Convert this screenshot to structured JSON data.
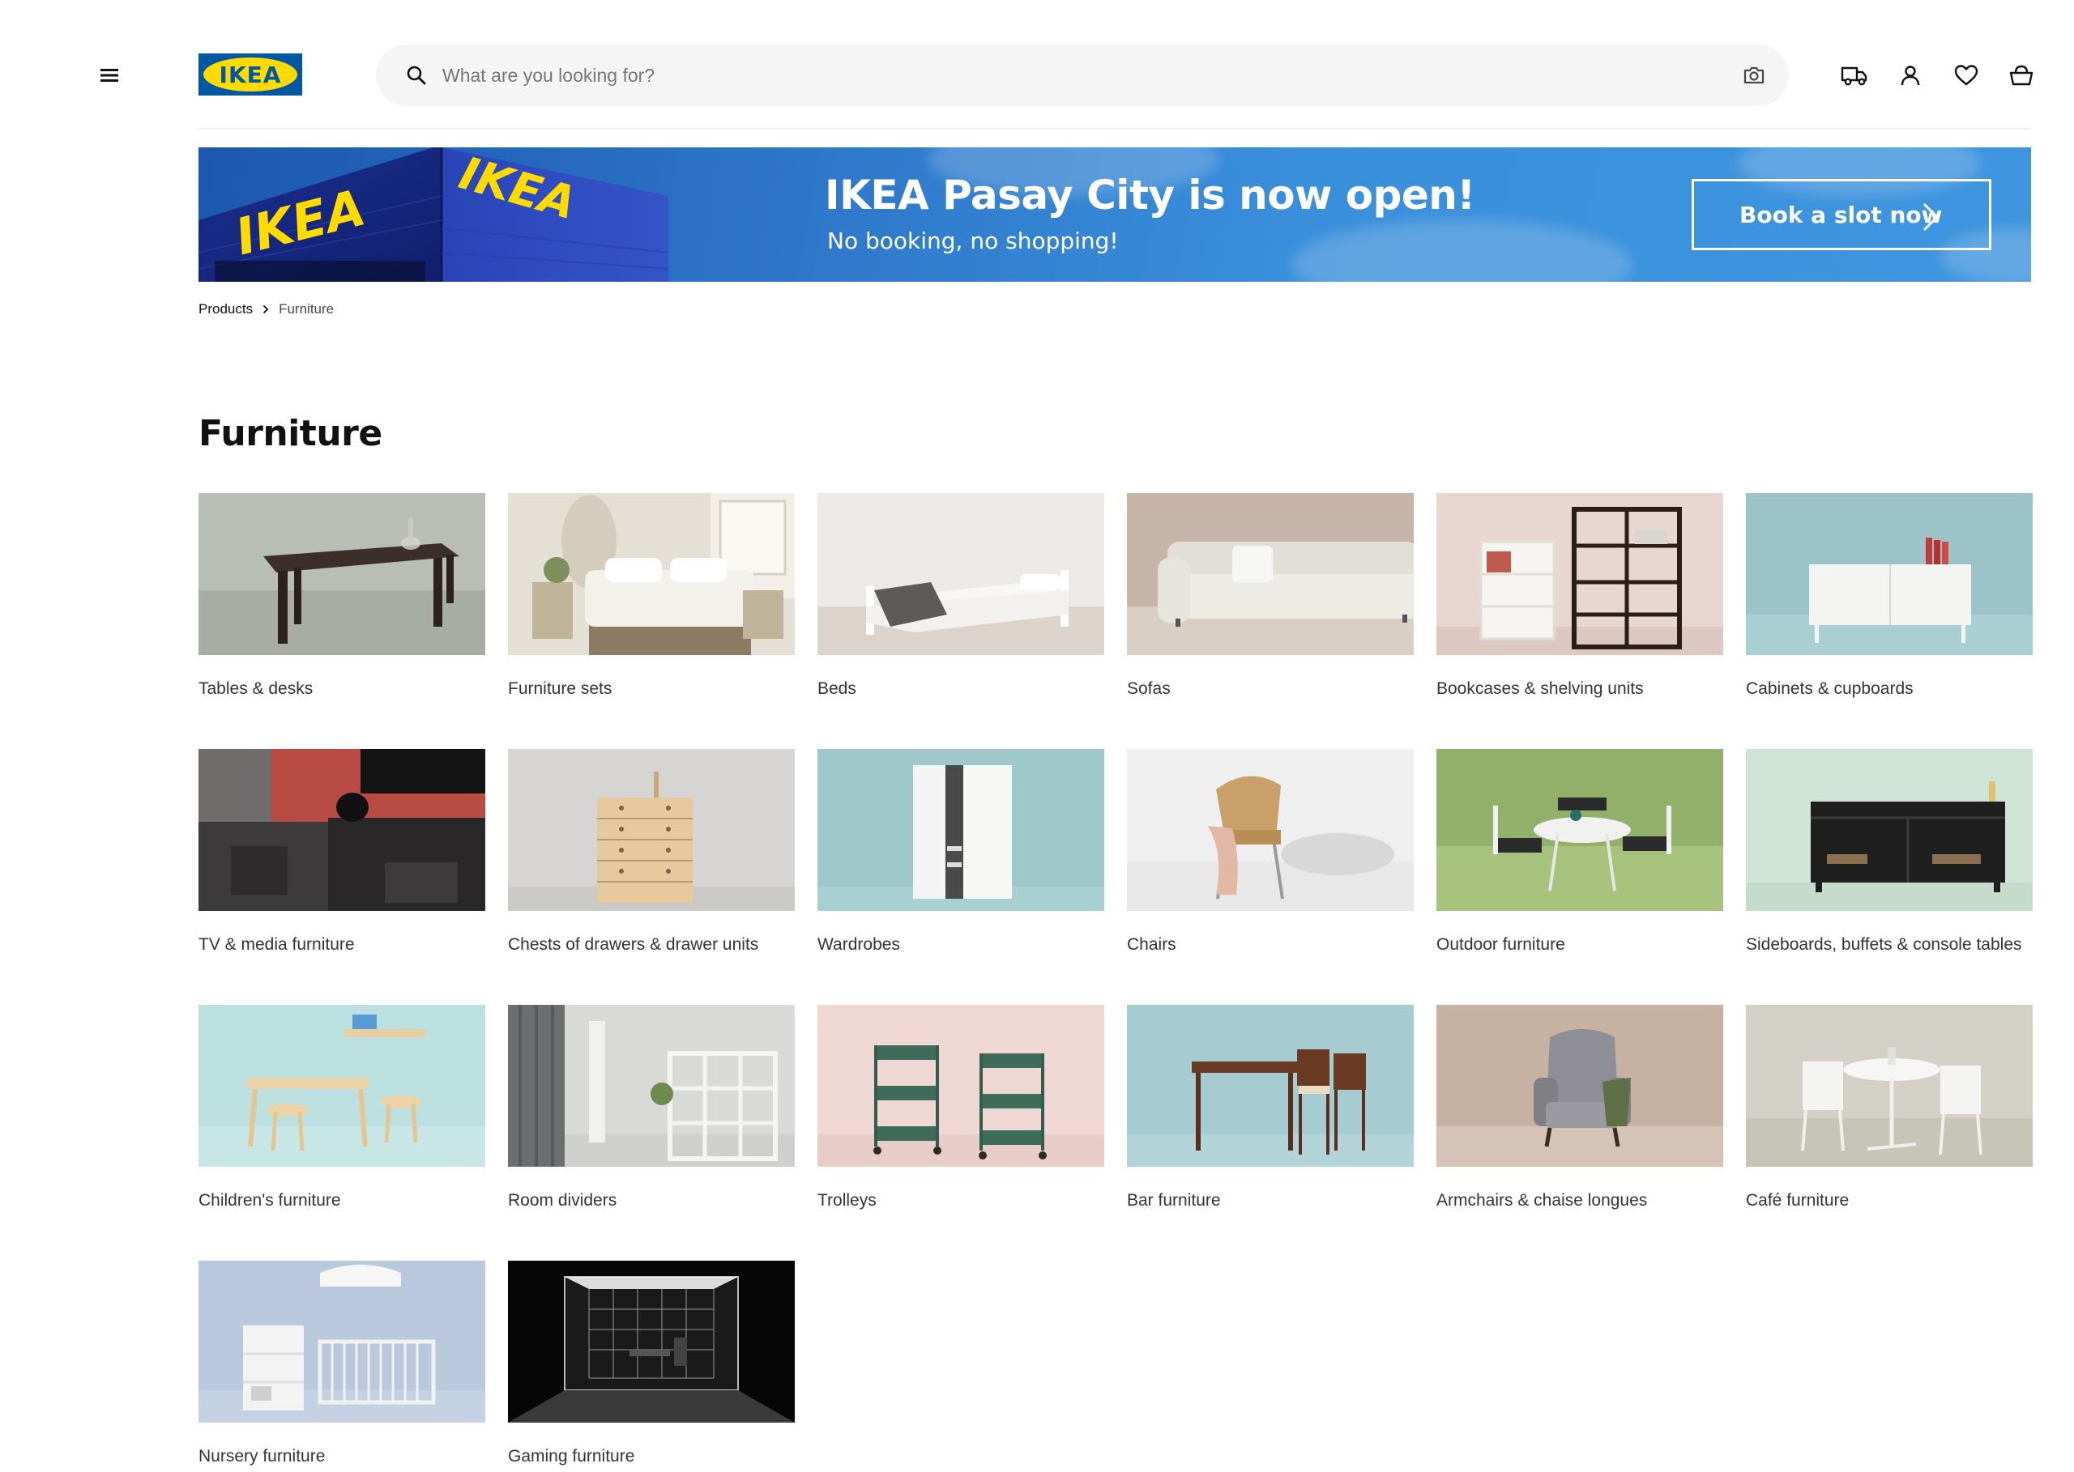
{
  "header": {
    "logo_text": "IKEA",
    "search": {
      "placeholder": "What are you looking for?"
    },
    "icons": [
      "menu-icon",
      "search-icon",
      "camera-icon",
      "truck-icon",
      "user-icon",
      "heart-icon",
      "basket-icon"
    ]
  },
  "banner": {
    "sign_text": "IKEA",
    "title": "IKEA Pasay City is now open!",
    "subtitle": "No booking, no shopping!",
    "button_label": "Book a slot now"
  },
  "breadcrumb": {
    "items": [
      "Products",
      "Furniture"
    ]
  },
  "page": {
    "title": "Furniture"
  },
  "categories": [
    {
      "label": "Tables & desks"
    },
    {
      "label": "Furniture sets"
    },
    {
      "label": "Beds"
    },
    {
      "label": "Sofas"
    },
    {
      "label": "Bookcases & shelving units"
    },
    {
      "label": "Cabinets & cupboards"
    },
    {
      "label": "TV & media furniture"
    },
    {
      "label": "Chests of drawers & drawer units"
    },
    {
      "label": "Wardrobes"
    },
    {
      "label": "Chairs"
    },
    {
      "label": "Outdoor furniture"
    },
    {
      "label": "Sideboards, buffets & console tables"
    },
    {
      "label": "Children's furniture"
    },
    {
      "label": "Room dividers"
    },
    {
      "label": "Trolleys"
    },
    {
      "label": "Bar furniture"
    },
    {
      "label": "Armchairs & chaise longues"
    },
    {
      "label": "Café furniture"
    },
    {
      "label": "Nursery furniture"
    },
    {
      "label": "Gaming furniture"
    }
  ],
  "colors": {
    "ikea_blue": "#0058a3",
    "ikea_yellow": "#ffdb00",
    "banner_blue": "#3a8fdb",
    "text": "#111111",
    "search_bg": "#f5f5f5"
  }
}
